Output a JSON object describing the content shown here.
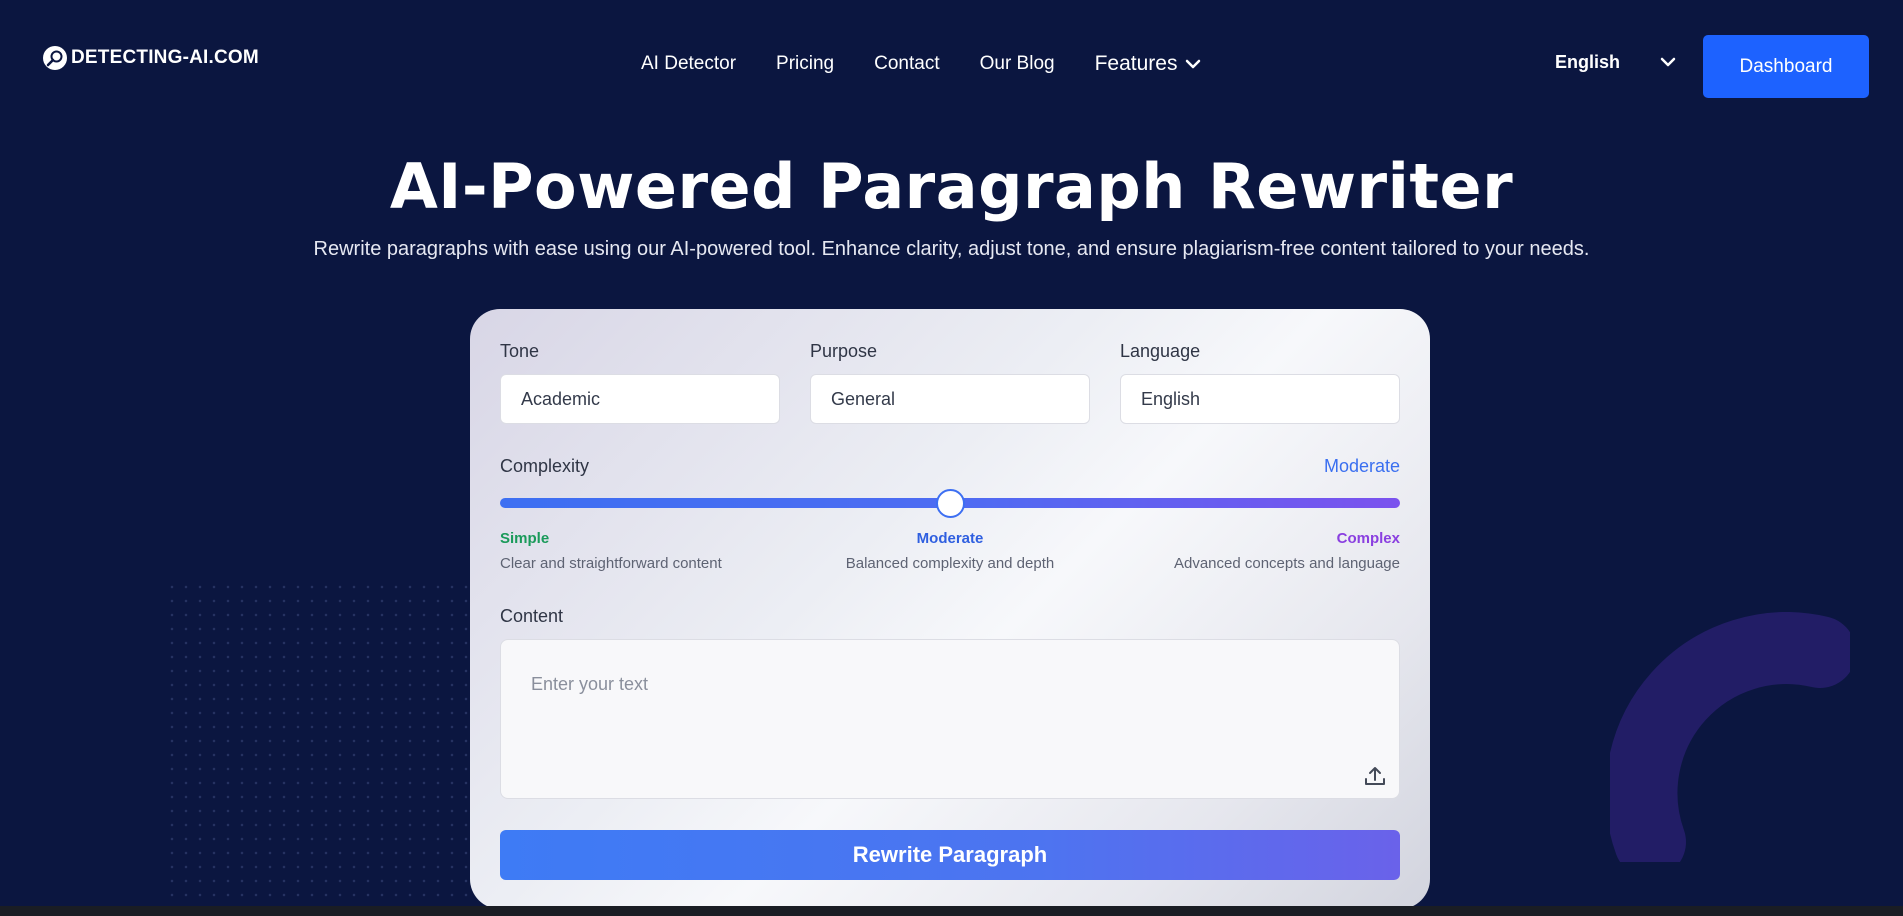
{
  "logo": {
    "text": "DETECTING-AI.COM",
    "icon": "magnifier-icon"
  },
  "nav": {
    "items": [
      "AI Detector",
      "Pricing",
      "Contact",
      "Our Blog"
    ],
    "features_label": "Features"
  },
  "language_selector": {
    "value": "English"
  },
  "dashboard_button": "Dashboard",
  "hero": {
    "title": "AI-Powered Paragraph Rewriter",
    "subtitle": "Rewrite paragraphs with ease using our AI-powered tool. Enhance clarity, adjust tone, and ensure plagiarism-free content tailored to your needs."
  },
  "form": {
    "tone": {
      "label": "Tone",
      "value": "Academic"
    },
    "purpose": {
      "label": "Purpose",
      "value": "General"
    },
    "language": {
      "label": "Language",
      "value": "English"
    },
    "complexity": {
      "label": "Complexity",
      "value": "Moderate",
      "level_fraction": 0.5,
      "levels": [
        {
          "name": "Simple",
          "desc": "Clear and straightforward content",
          "color": "#1a9a5a"
        },
        {
          "name": "Moderate",
          "desc": "Balanced complexity and depth",
          "color": "#2f5fe0"
        },
        {
          "name": "Complex",
          "desc": "Advanced concepts and language",
          "color": "#8a3fe0"
        }
      ]
    },
    "content": {
      "label": "Content",
      "placeholder": "Enter your text"
    },
    "submit_label": "Rewrite Paragraph"
  },
  "colors": {
    "background": "#0b1640",
    "accent": "#1d62ff"
  }
}
